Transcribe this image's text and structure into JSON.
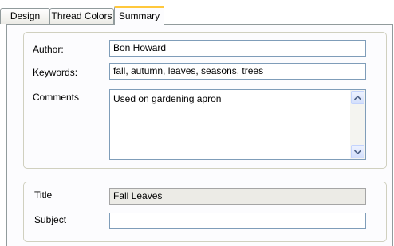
{
  "tabs": [
    {
      "label": "Design",
      "active": false
    },
    {
      "label": "Thread Colors",
      "active": false
    },
    {
      "label": "Summary",
      "active": true
    }
  ],
  "summary": {
    "author": {
      "label": "Author:",
      "value": "Bon Howard"
    },
    "keywords": {
      "label": "Keywords:",
      "value": "fall, autumn, leaves, seasons, trees"
    },
    "comments": {
      "label": "Comments",
      "value": "Used on gardening apron"
    }
  },
  "info": {
    "title": {
      "label": "Title",
      "value": "Fall Leaves"
    },
    "subject": {
      "label": "Subject",
      "value": ""
    }
  },
  "icons": {
    "scroll_up": "chevron-up-icon",
    "scroll_down": "chevron-down-icon"
  },
  "colors": {
    "active_tab_accent": "#ffc83c",
    "field_border": "#7f9db9",
    "readonly_field_bg": "#ecebe6",
    "panel_border": "#919b9c"
  }
}
